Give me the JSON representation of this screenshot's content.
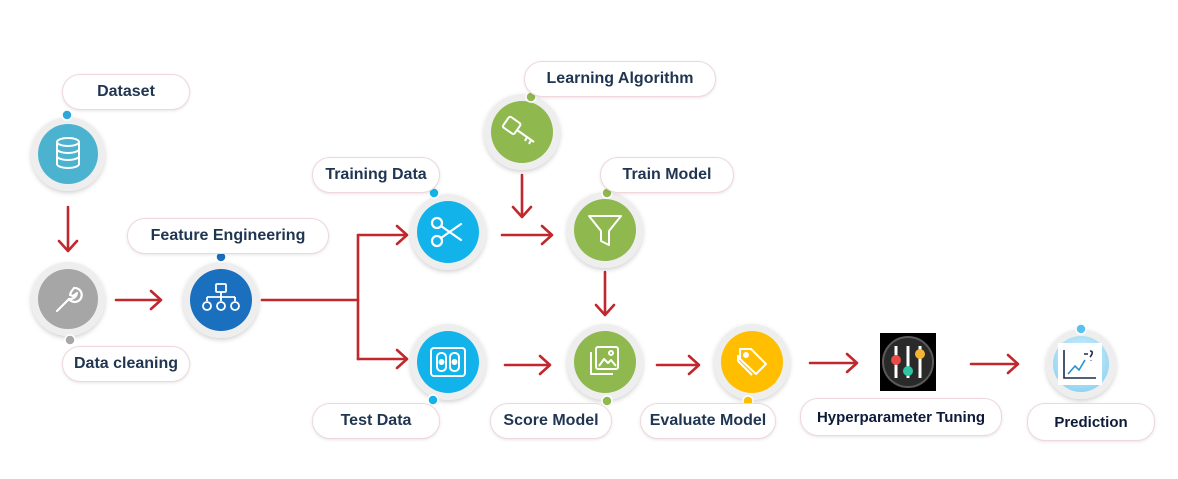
{
  "steps": {
    "dataset": "Dataset",
    "data_cleaning": "Data cleaning",
    "feature_engineering": "Feature Engineering",
    "training_data": "Training Data",
    "test_data": "Test  Data",
    "learning_algorithm": "Learning Algorithm",
    "train_model": "Train Model",
    "score_model": "Score Model",
    "evaluate_model": "Evaluate Model",
    "hyperparameter_tuning": "Hyperparameter Tuning",
    "prediction": "Prediction"
  },
  "colors": {
    "teal": "#4bb3cf",
    "gray": "#a6a6a6",
    "navy": "#1a6fbe",
    "cyan": "#12b3ea",
    "green": "#8fb84f",
    "amber": "#ffbf00",
    "arrow": "#c0282d",
    "label_text": "#1f3551"
  },
  "icons": {
    "dataset": "database-icon",
    "data_cleaning": "wrench-icon",
    "feature_engineering": "hierarchy-icon",
    "training_data": "scissors-icon",
    "test_data": "storage-icon",
    "learning_algorithm": "key-icon",
    "train_model": "funnel-icon",
    "score_model": "image-stack-icon",
    "evaluate_model": "tags-icon",
    "hyperparameter_tuning": "sliders-icon",
    "prediction": "trend-chart-icon"
  }
}
